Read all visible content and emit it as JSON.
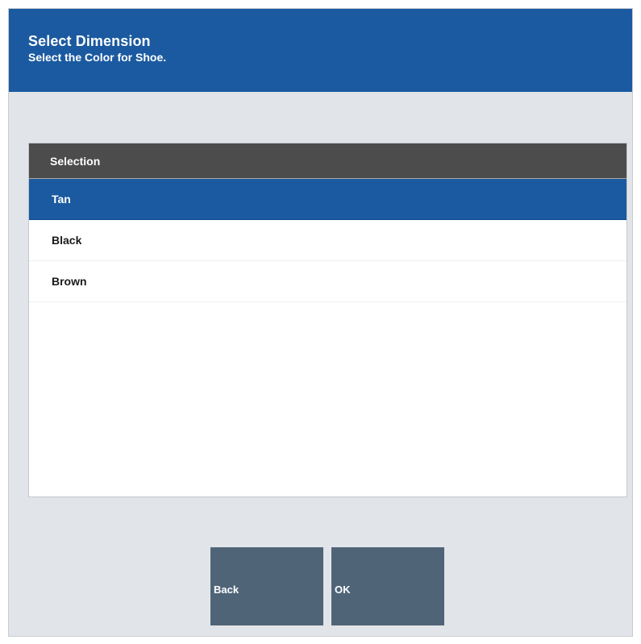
{
  "header": {
    "title": "Select Dimension",
    "subtitle": "Select the Color for Shoe."
  },
  "list": {
    "column_header": "Selection",
    "items": [
      {
        "label": "Tan",
        "selected": true
      },
      {
        "label": "Black",
        "selected": false
      },
      {
        "label": "Brown",
        "selected": false
      }
    ]
  },
  "buttons": {
    "back_label": "Back",
    "ok_label": "OK"
  },
  "colors": {
    "header_bg": "#1b5aa0",
    "selected_row_bg": "#1b5aa0",
    "list_header_bg": "#4c4c4c",
    "button_bg": "#506478",
    "screen_bg": "#e1e4e9"
  }
}
